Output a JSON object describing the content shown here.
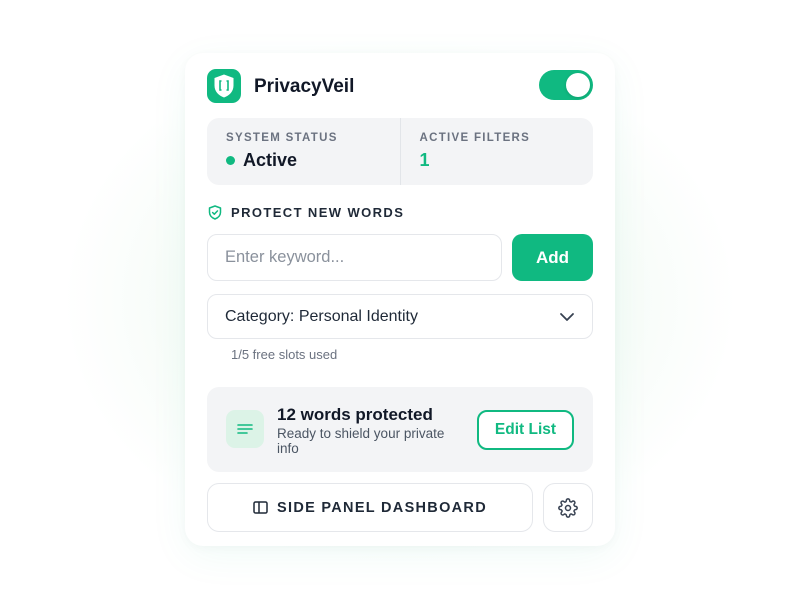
{
  "app": {
    "title": "PrivacyVeil",
    "enabled": true
  },
  "colors": {
    "accent": "#10b981",
    "accent_light": "#dcf3e7",
    "panel_bg": "#f3f4f6"
  },
  "status": {
    "system_label": "SYSTEM STATUS",
    "system_value": "Active",
    "filters_label": "ACTIVE FILTERS",
    "filters_value": "1"
  },
  "protect": {
    "title": "PROTECT NEW WORDS",
    "icon": "shield-check-icon",
    "input_value": "",
    "input_placeholder": "Enter keyword...",
    "add_label": "Add",
    "category_value": "Category: Personal Identity",
    "slots_text": "1/5 free slots used"
  },
  "words": {
    "icon": "list-icon",
    "title": "12 words protected",
    "subtitle": "Ready to shield your private info",
    "edit_label": "Edit List"
  },
  "footer": {
    "dashboard_label": "SIDE PANEL DASHBOARD",
    "dashboard_icon": "side-panel-icon",
    "settings_icon": "gear-icon"
  }
}
